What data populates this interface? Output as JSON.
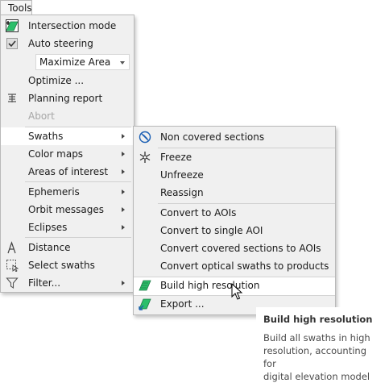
{
  "menubar": {
    "tools": "Tools"
  },
  "main_menu": {
    "intersection_mode": "Intersection mode",
    "auto_steering": "Auto steering",
    "combo_value": "Maximize Area",
    "optimize": "Optimize ...",
    "planning_report": "Planning report",
    "abort": "Abort",
    "swaths": "Swaths",
    "color_maps": "Color maps",
    "areas_of_interest": "Areas of interest",
    "ephemeris": "Ephemeris",
    "orbit_messages": "Orbit messages",
    "eclipses": "Eclipses",
    "distance": "Distance",
    "select_swaths": "Select swaths",
    "filter": "Filter..."
  },
  "swaths_menu": {
    "non_covered_sections": "Non covered sections",
    "freeze": "Freeze",
    "unfreeze": "Unfreeze",
    "reassign": "Reassign",
    "convert_to_aois": "Convert to AOIs",
    "convert_to_single_aoi": "Convert to single AOI",
    "convert_covered_sections": "Convert covered sections to AOIs",
    "convert_optical_swaths": "Convert optical swaths to products",
    "build_high_resolution": "Build high resolution",
    "export": "Export ..."
  },
  "tooltip": {
    "title": "Build high resolution",
    "line1": "Build all swaths in high",
    "line2": "resolution, accounting for",
    "line3": "digital elevation model"
  },
  "colors": {
    "menu_bg": "#f0f0f0",
    "accent_green": "#2bbf6a",
    "icon_blue": "#1a5fb4"
  }
}
